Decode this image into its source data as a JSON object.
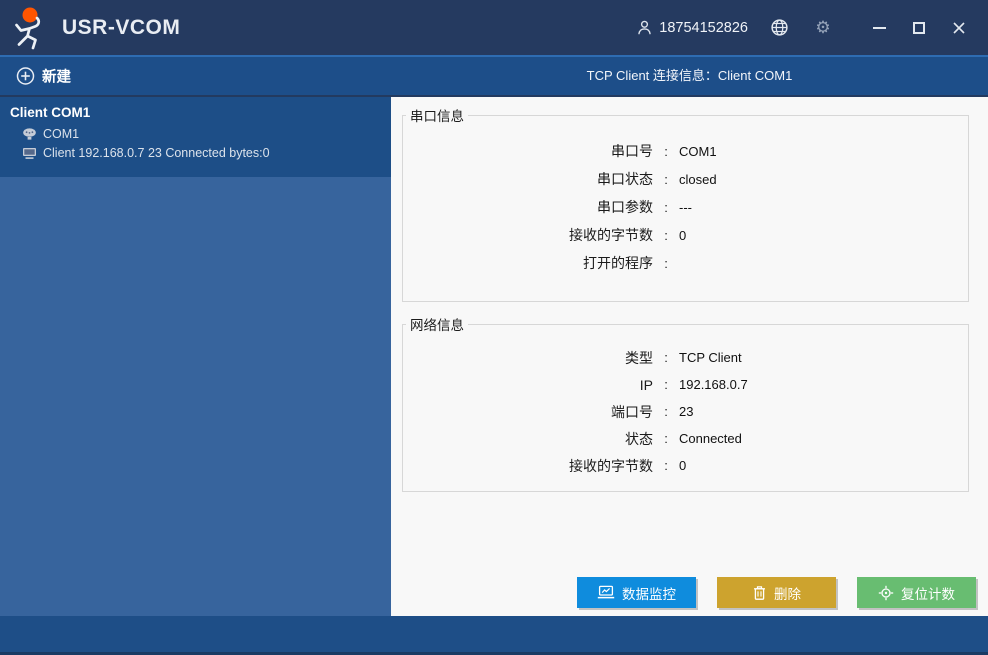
{
  "titlebar": {
    "app_title": "USR-VCOM",
    "user_id": "18754152826"
  },
  "menubar": {
    "new_label": "新建",
    "connection_info": "TCP Client 连接信息：Client COM1"
  },
  "sidebar": {
    "item": {
      "title": "Client COM1",
      "port": "COM1",
      "link": "Client 192.168.0.7 23 Connected bytes:0"
    }
  },
  "serial_info": {
    "legend": "串口信息",
    "rows": [
      {
        "label": "串口号",
        "value": "COM1"
      },
      {
        "label": "串口状态",
        "value": "closed"
      },
      {
        "label": "串口参数",
        "value": "---"
      },
      {
        "label": "接收的字节数",
        "value": "0"
      },
      {
        "label": "打开的程序",
        "value": ""
      }
    ]
  },
  "network_info": {
    "legend": "网络信息",
    "rows": [
      {
        "label": "类型",
        "value": "TCP Client"
      },
      {
        "label": "IP",
        "value": "192.168.0.7"
      },
      {
        "label": "端口号",
        "value": "23"
      },
      {
        "label": "状态",
        "value": "Connected"
      },
      {
        "label": "接收的字节数",
        "value": "0"
      }
    ]
  },
  "buttons": {
    "monitor_label": "数据监控",
    "delete_label": "删除",
    "reset_label": "复位计数"
  },
  "punct": {
    "colon": ":"
  },
  "icons": {
    "gear": "⚙"
  },
  "colors": {
    "titlebar_bg": "#253a60",
    "menubar_bg": "#1d4e89",
    "menubar_highlight": "#2e6cb2",
    "sidebar_bg": "#37649d",
    "selected_item_bg": "#1d4e87",
    "panel_bg": "#f8f8f8",
    "footer_bg": "#1e4e87",
    "logo_orange": "#ff5500",
    "btn_monitor": "#0f8cdd",
    "btn_delete": "#cda32e",
    "btn_reset": "#68bd71"
  }
}
